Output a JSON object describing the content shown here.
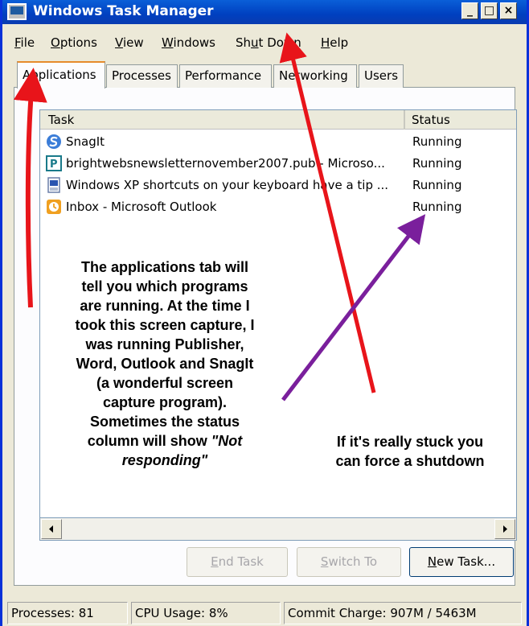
{
  "window": {
    "title": "Windows Task Manager"
  },
  "window_controls": {
    "minimize": "_",
    "maximize": "□",
    "close": "×"
  },
  "menu": [
    {
      "pre": "",
      "acc": "F",
      "post": "ile"
    },
    {
      "pre": "",
      "acc": "O",
      "post": "ptions"
    },
    {
      "pre": "",
      "acc": "V",
      "post": "iew"
    },
    {
      "pre": "",
      "acc": "W",
      "post": "indows"
    },
    {
      "pre": "Sh",
      "acc": "u",
      "post": "t Down"
    },
    {
      "pre": "",
      "acc": "H",
      "post": "elp"
    }
  ],
  "tabs": [
    "Applications",
    "Processes",
    "Performance",
    "Networking",
    "Users"
  ],
  "active_tab": "Applications",
  "list": {
    "columns": {
      "task": "Task",
      "status": "Status"
    },
    "rows": [
      {
        "icon": "snagit-icon",
        "task": "SnagIt",
        "status": "Running"
      },
      {
        "icon": "publisher-icon",
        "task": "brightwebsnewsletternovember2007.pub - Microso...",
        "status": "Running"
      },
      {
        "icon": "word-document-icon",
        "task": "Windows XP shortcuts on your keyboard have a tip ...",
        "status": "Running"
      },
      {
        "icon": "outlook-icon",
        "task": "Inbox - Microsoft Outlook",
        "status": "Running"
      }
    ]
  },
  "buttons": {
    "end_task": {
      "acc": "E",
      "rest": "nd Task"
    },
    "switch_to": {
      "acc": "S",
      "rest": "witch To"
    },
    "new_task": {
      "acc": "N",
      "rest": "ew Task..."
    }
  },
  "statusbar": {
    "processes": "Processes: 81",
    "cpu": "CPU Usage: 8%",
    "commit": "Commit Charge: 907M / 5463M"
  },
  "annotations": {
    "left_lines": [
      "The applications tab will",
      "tell you which programs",
      "are running. At the time I",
      "took this screen capture, I",
      "was running Publisher,",
      "Word, Outlook and SnagIt",
      "(a wonderful screen",
      "capture program).",
      "Sometimes the status",
      "column will show"
    ],
    "left_emphasis_1": "\"Not",
    "left_emphasis_2": "responding\"",
    "right_lines": [
      "If it's really stuck you",
      "can force a shutdown"
    ]
  },
  "colors": {
    "titlebar": "#0040c0",
    "arrow_red": "#e8141a",
    "arrow_purple": "#7a1f9c",
    "tab_highlight": "#e68b2c"
  }
}
